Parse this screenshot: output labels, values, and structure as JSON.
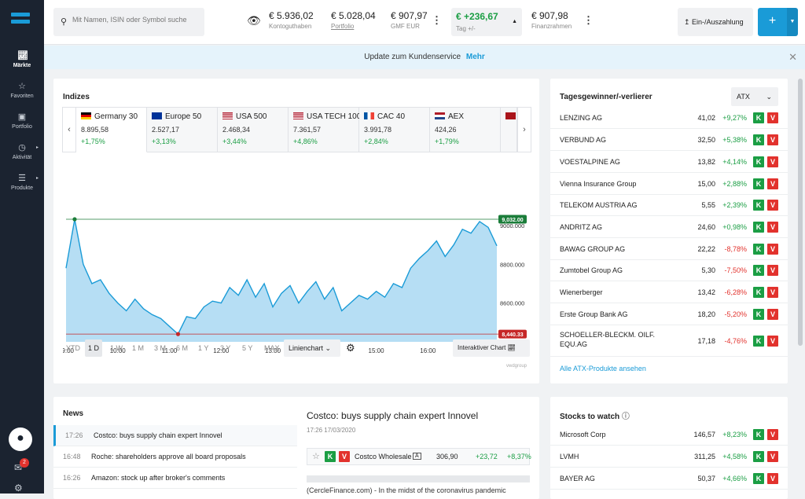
{
  "sidebar": {
    "items": [
      {
        "label": "Märkte",
        "icon": "chart-icon"
      },
      {
        "label": "Favoriten",
        "icon": "star-icon"
      },
      {
        "label": "Portfolio",
        "icon": "portfolio-icon"
      },
      {
        "label": "Aktivität",
        "icon": "clock-icon"
      },
      {
        "label": "Produkte",
        "icon": "search-list-icon"
      }
    ],
    "mail_badge": "2"
  },
  "header": {
    "search_placeholder": "Mit Namen, ISIN oder Symbol suche",
    "balances": [
      {
        "value": "€ 5.936,02",
        "label": "Kontoguthaben"
      },
      {
        "value": "€ 5.028,04",
        "label": "Portfolio"
      },
      {
        "value": "€ 907,97",
        "label": "GMF EUR"
      }
    ],
    "day_change": {
      "value": "€ +236,67",
      "label": "Tag +/-"
    },
    "credit": {
      "value": "€ 907,98",
      "label": "Finanzrahmen"
    },
    "deposit_button": "Ein-/Auszahlung",
    "plus_button": "+"
  },
  "banner": {
    "text": "Update zum Kundenservice",
    "link": "Mehr"
  },
  "indices": {
    "title": "Indizes",
    "tabs": [
      {
        "name": "Germany 30",
        "price": "8.895,58",
        "change": "+1,75%"
      },
      {
        "name": "Europe 50",
        "price": "2.527,17",
        "change": "+3,13%"
      },
      {
        "name": "USA 500",
        "price": "2.468,34",
        "change": "+3,44%"
      },
      {
        "name": "USA TECH 100",
        "price": "7.361,57",
        "change": "+4,86%"
      },
      {
        "name": "CAC 40",
        "price": "3.991,78",
        "change": "+2,84%"
      },
      {
        "name": "AEX",
        "price": "424,26",
        "change": "+1,79%"
      }
    ],
    "timeframes": [
      "YTD",
      "1 D",
      "1 W",
      "1 M",
      "3 M",
      "6 M",
      "1 Y",
      "3 Y",
      "5 Y",
      "MAX"
    ],
    "selected_timeframe": "1 D",
    "chart_type": "Linienchart",
    "interactive": "Interaktiver Chart",
    "source": "vwdgroup"
  },
  "chart_data": {
    "type": "area",
    "title": "",
    "xlabel": "",
    "ylabel": "",
    "x_ticks": [
      "09:00",
      "10:00",
      "11:00",
      "12:00",
      "13:00",
      "14:00",
      "15:00",
      "16:00",
      "17:00"
    ],
    "y_ticks": [
      "9000.000",
      "8800.000",
      "8600.000",
      "8400.000"
    ],
    "ylim": [
      8400,
      9040
    ],
    "high_label": "9,032.00",
    "low_label": "8,440.33",
    "series": [
      {
        "x": [
          "09:00",
          "09:10",
          "09:20",
          "09:30",
          "09:40",
          "09:50",
          "10:00",
          "10:10",
          "10:20",
          "10:30",
          "10:40",
          "10:50",
          "11:00",
          "11:10",
          "11:20",
          "11:30",
          "11:40",
          "11:50",
          "12:00",
          "12:10",
          "12:20",
          "12:30",
          "12:40",
          "12:50",
          "13:00",
          "13:10",
          "13:20",
          "13:30",
          "13:40",
          "13:50",
          "14:00",
          "14:10",
          "14:20",
          "14:30",
          "14:40",
          "14:50",
          "15:00",
          "15:10",
          "15:20",
          "15:30",
          "15:40",
          "15:50",
          "16:00",
          "16:10",
          "16:20",
          "16:30",
          "16:40",
          "16:50",
          "17:00",
          "17:10",
          "17:20"
        ],
        "values": [
          8780,
          9032,
          8800,
          8700,
          8720,
          8650,
          8600,
          8560,
          8620,
          8570,
          8540,
          8520,
          8480,
          8440,
          8530,
          8520,
          8580,
          8610,
          8600,
          8680,
          8640,
          8720,
          8630,
          8700,
          8580,
          8650,
          8690,
          8600,
          8660,
          8710,
          8620,
          8680,
          8560,
          8600,
          8640,
          8620,
          8660,
          8630,
          8700,
          8680,
          8780,
          8830,
          8870,
          8920,
          8840,
          8900,
          8980,
          8960,
          9020,
          8990,
          8895
        ]
      }
    ]
  },
  "movers": {
    "title": "Tagesgewinner/-verlierer",
    "selector": "ATX",
    "rows": [
      {
        "name": "LENZING AG",
        "price": "41,02",
        "change": "+9,27%"
      },
      {
        "name": "VERBUND AG",
        "price": "32,50",
        "change": "+5,38%"
      },
      {
        "name": "VOESTALPINE AG",
        "price": "13,82",
        "change": "+4,14%"
      },
      {
        "name": "Vienna Insurance Group",
        "price": "15,00",
        "change": "+2,88%"
      },
      {
        "name": "TELEKOM AUSTRIA AG",
        "price": "5,55",
        "change": "+2,39%"
      },
      {
        "name": "ANDRITZ AG",
        "price": "24,60",
        "change": "+0,98%"
      },
      {
        "name": "BAWAG GROUP AG",
        "price": "22,22",
        "change": "-8,78%"
      },
      {
        "name": "Zumtobel Group AG",
        "price": "5,30",
        "change": "-7,50%"
      },
      {
        "name": "Wienerberger",
        "price": "13,42",
        "change": "-6,28%"
      },
      {
        "name": "Erste Group Bank AG",
        "price": "18,20",
        "change": "-5,20%"
      },
      {
        "name": "SCHOELLER-BLECKM. OILF.",
        "name2": "EQU.AG",
        "price": "17,18",
        "change": "-4,76%"
      }
    ],
    "all_link": "Alle ATX-Produkte ansehen",
    "buy": "K",
    "sell": "V"
  },
  "news": {
    "title": "News",
    "items": [
      {
        "time": "17:26",
        "headline": "Costco: buys supply chain expert Innovel"
      },
      {
        "time": "16:48",
        "headline": "Roche: shareholders approve all board proposals"
      },
      {
        "time": "16:26",
        "headline": "Amazon: stock up after broker's comments"
      }
    ],
    "article": {
      "title": "Costco: buys supply chain expert Innovel",
      "date": "17:26 17/03/2020",
      "stock": {
        "name": "Costco Wholesale",
        "tag": "A",
        "price": "306,90",
        "change": "+23,72",
        "pct": "+8,37%"
      },
      "text": "(CercleFinance.com) - In the midst of the coronavirus pandemic"
    }
  },
  "watch": {
    "title": "Stocks to watch",
    "rows": [
      {
        "name": "Microsoft Corp",
        "price": "146,57",
        "change": "+8,23%"
      },
      {
        "name": "LVMH",
        "price": "311,25",
        "change": "+4,58%"
      },
      {
        "name": "BAYER AG",
        "price": "50,37",
        "change": "+4,66%"
      }
    ]
  }
}
